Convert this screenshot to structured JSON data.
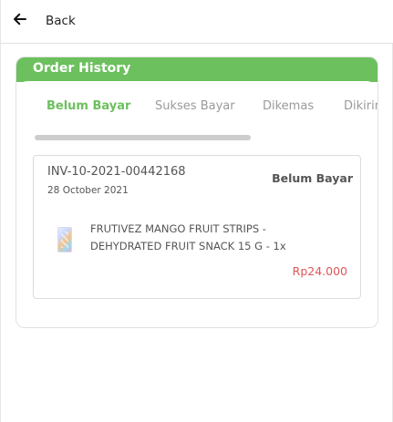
{
  "header": {
    "back_label": "Back"
  },
  "panel": {
    "title": "Order History",
    "tabs": [
      {
        "label": "Belum Bayar",
        "active": true
      },
      {
        "label": "Sukses Bayar",
        "active": false
      },
      {
        "label": "Dikemas",
        "active": false
      },
      {
        "label": "Dikirim",
        "active": false
      }
    ]
  },
  "order": {
    "invoice": "INV-10-2021-00442168",
    "date": "28 October 2021",
    "status": "Belum Bayar",
    "product": "FRUTIVEZ MANGO FRUIT STRIPS - DEHYDRATED FRUIT SNACK 15 G - 1x",
    "price": "Rp24.000"
  },
  "colors": {
    "accent": "#6cc05e",
    "price": "#e05656"
  }
}
